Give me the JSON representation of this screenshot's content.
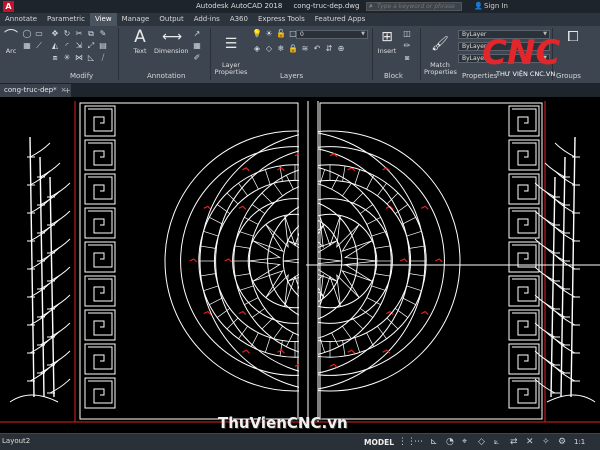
{
  "titlebar": {
    "app_name": "Autodesk AutoCAD 2018",
    "file_name": "cong-truc-dep.dwg",
    "search_placeholder": "Type a keyword or phrase",
    "sign_in": "Sign In",
    "logo_letter": "A"
  },
  "ribbon_tabs": [
    {
      "label": "Annotate"
    },
    {
      "label": "Parametric"
    },
    {
      "label": "View"
    },
    {
      "label": "Manage"
    },
    {
      "label": "Output"
    },
    {
      "label": "Add-ins"
    },
    {
      "label": "A360"
    },
    {
      "label": "Express Tools"
    },
    {
      "label": "Featured Apps"
    }
  ],
  "ribbon": {
    "arc_label": "Arc",
    "text_label": "Text",
    "dimension_label": "Dimension",
    "layer_props_label": "Layer\nProperties",
    "insert_label": "Insert",
    "match_props_label": "Match\nProperties",
    "group_label": "Group",
    "modify_panel": "Modify",
    "annotation_panel": "Annotation",
    "layers_panel": "Layers",
    "block_panel": "Block",
    "properties_panel": "Properties",
    "groups_panel": "Groups",
    "layer_value": "0",
    "bylayer_1": "ByLayer",
    "bylayer_2": "ByLayer",
    "bylayer_3": "ByLayer"
  },
  "file_tab": {
    "name": "cong-truc-dep*",
    "close": "×",
    "new": "+"
  },
  "brand": {
    "logo_text": "CNC",
    "logo_sub": "THƯ VIỆN CNC.VN",
    "watermark": "ThuVienCNC.vn"
  },
  "statusbar": {
    "layout": "Layout2",
    "model": "MODEL",
    "scale": "1:1"
  },
  "colors": {
    "accent_red": "#c8102e",
    "drawing_white": "#ffffff",
    "drawing_red": "#e02020"
  }
}
